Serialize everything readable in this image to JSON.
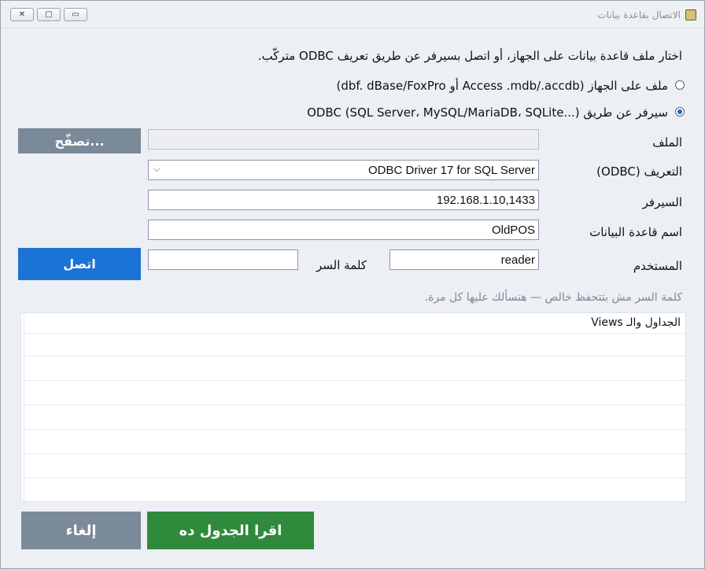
{
  "window": {
    "title": "الاتصال بقاعدة بيانات",
    "close_glyph": "✕",
    "maximize_glyph": "▢",
    "minimize_glyph": "▭"
  },
  "instructions": "اختار ملف قاعدة بيانات على الجهاز، أو اتصل بسيرفر عن طريق تعريف ODBC متركّب.",
  "options": {
    "local_file": {
      "label": "ملف على الجهاز (Access .mdb/.accdb أو dbf. dBase/FoxPro)",
      "selected": false
    },
    "odbc": {
      "label": "سيرفر عن طريق ODBC (SQL Server، MySQL/MariaDB، SQLite...)",
      "selected": true
    }
  },
  "form": {
    "file_label": "الملف",
    "file_value": "",
    "browse_label": "تصفّح...",
    "driver_label": "التعريف (ODBC)",
    "driver_value": "ODBC Driver 17 for SQL Server",
    "server_label": "السيرفر",
    "server_value": "192.168.1.10,1433",
    "database_label": "اسم قاعدة البيانات",
    "database_value": "OldPOS",
    "user_label": "المستخدم",
    "user_value": "reader",
    "password_label": "كلمة السر",
    "password_value": "",
    "connect_label": "اتصل",
    "password_note": "كلمة السر مش بتتحفظ خالص — هنسألك عليها كل مرة."
  },
  "tables": {
    "header": "الجداول والـ Views",
    "rows": []
  },
  "footer": {
    "read_table_label": "اقرا الجدول ده",
    "cancel_label": "إلغاء"
  },
  "colors": {
    "primary_blue": "#1c73d6",
    "accent_green": "#2f8a3c",
    "muted_gray": "#7b8a98"
  }
}
